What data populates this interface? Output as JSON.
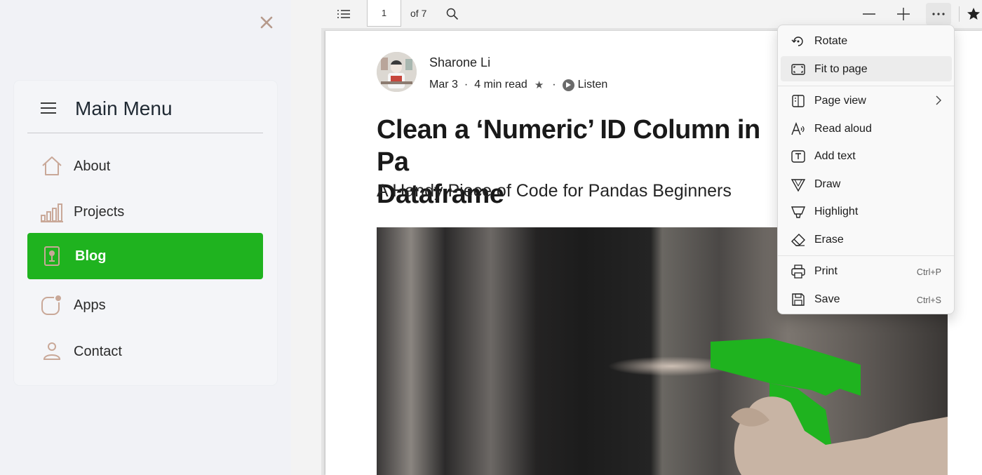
{
  "sidebar": {
    "title": "Main Menu",
    "items": [
      {
        "label": "About",
        "icon": "home-icon"
      },
      {
        "label": "Projects",
        "icon": "bar-chart-icon"
      },
      {
        "label": "Blog",
        "icon": "blog-icon",
        "active": true
      },
      {
        "label": "Apps",
        "icon": "apps-icon"
      },
      {
        "label": "Contact",
        "icon": "user-icon"
      }
    ],
    "accent_color": "#1fb31f",
    "icon_color": "#c9a898"
  },
  "toolbar": {
    "page_current": "1",
    "page_total_label": "of 7"
  },
  "article": {
    "author": "Sharone Li",
    "date": "Mar 3",
    "read_time": "4 min read",
    "listen_label": "Listen",
    "title": "Clean a ‘Numeric’ ID Column in Pa",
    "title_line2": "Dataframe",
    "subtitle": "A Handy Piece of Code for Pandas Beginners"
  },
  "overflow_menu": {
    "items": [
      {
        "label": "Rotate",
        "icon": "rotate-icon"
      },
      {
        "label": "Fit to page",
        "icon": "fit-to-page-icon"
      },
      {
        "label": "Page view",
        "icon": "page-view-icon"
      },
      {
        "label": "Read aloud",
        "icon": "read-aloud-icon"
      },
      {
        "label": "Add text",
        "icon": "add-text-icon"
      },
      {
        "label": "Draw",
        "icon": "draw-icon"
      },
      {
        "label": "Highlight",
        "icon": "highlight-icon"
      },
      {
        "label": "Erase",
        "icon": "erase-icon"
      },
      {
        "label": "Print",
        "icon": "print-icon",
        "shortcut": "Ctrl+P"
      },
      {
        "label": "Save",
        "icon": "save-icon",
        "shortcut": "Ctrl+S"
      }
    ]
  }
}
